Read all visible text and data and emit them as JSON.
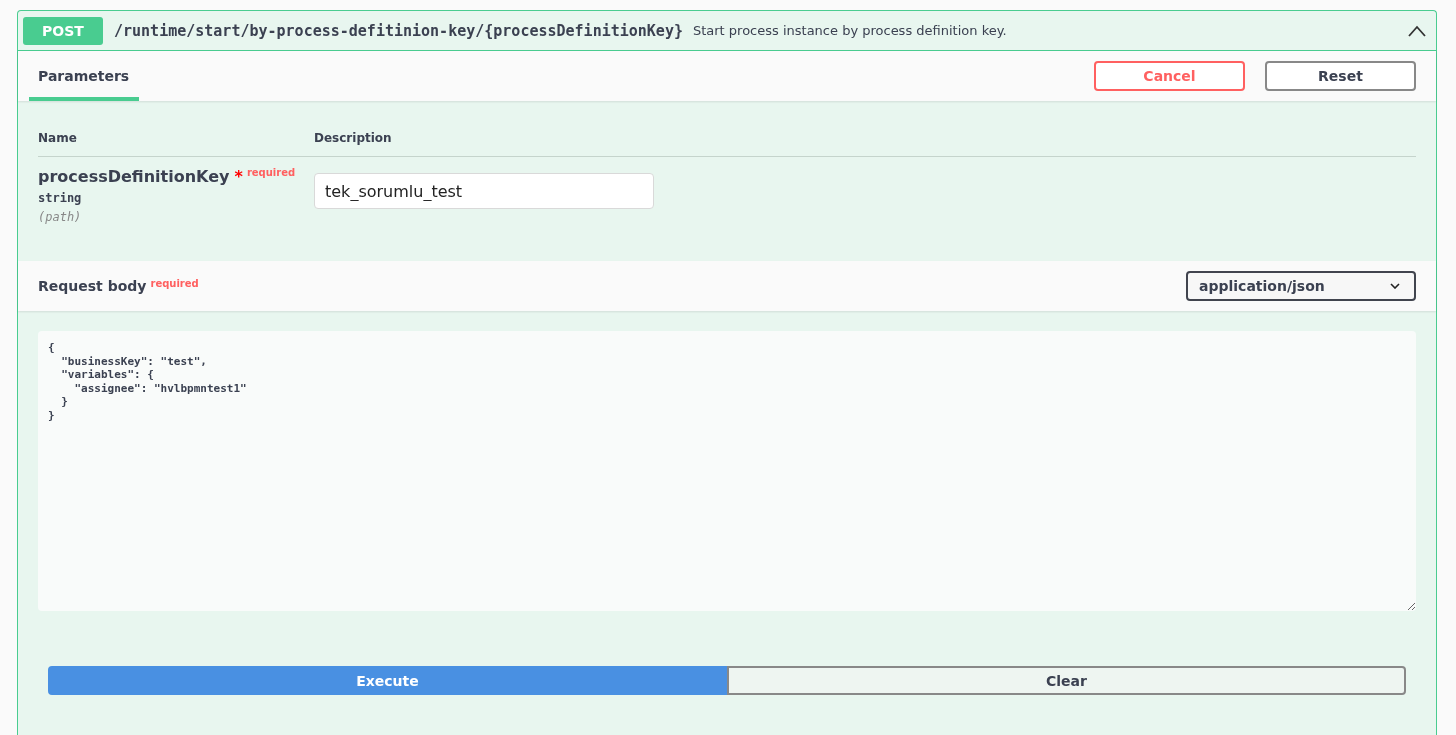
{
  "operation": {
    "method": "POST",
    "path": "/runtime/start/by-process-defitinion-key/{processDefinitionKey}",
    "summary": "Start process instance by process definition key.",
    "expanded": true
  },
  "tabs": [
    {
      "label": "Parameters",
      "selected": true
    }
  ],
  "header_buttons": [
    {
      "label": "Cancel",
      "kind": "cancel"
    },
    {
      "label": "Reset",
      "kind": "reset"
    }
  ],
  "parameters": {
    "columns": [
      "Name",
      "Description"
    ],
    "rows": [
      {
        "name": "processDefinitionKey",
        "required_mark": "*",
        "required": "required",
        "type": "string",
        "location": "(path)",
        "value": "tek_sorumlu_test"
      }
    ]
  },
  "request_body": {
    "title": "Request body",
    "required": "required",
    "content_type": "application/json",
    "value": "{\n  \"businessKey\": \"test\",\n  \"variables\": {\n    \"assignee\": \"hvlbpmntest1\"\n  }\n}"
  },
  "actions": [
    {
      "label": "Execute",
      "kind": "primary"
    },
    {
      "label": "Clear",
      "kind": "secondary"
    }
  ]
}
